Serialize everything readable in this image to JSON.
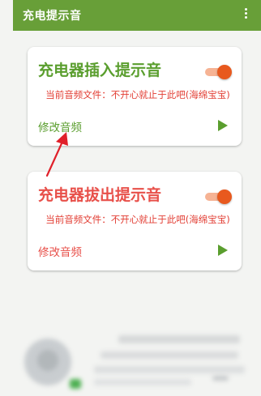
{
  "app_bar": {
    "title": "充电提示音",
    "menu_icon": "more-vert-icon",
    "color": "#689f38"
  },
  "cards": [
    {
      "title": "充电器插入提示音",
      "title_color": "#5a9e2e",
      "toggle_on": true,
      "current_file": "当前音频文件：不开心就止于此吧(海绵宝宝)",
      "modify_label": "修改音频",
      "modify_color": "#5a9e2e",
      "play_icon": "play-icon"
    },
    {
      "title": "充电器拔出提示音",
      "title_color": "#e8504a",
      "toggle_on": true,
      "current_file": "当前音频文件：不开心就止于此吧(海绵宝宝)",
      "modify_label": "修改音频",
      "modify_color": "#e8504a",
      "play_icon": "play-icon"
    }
  ],
  "colors": {
    "toggle_thumb": "#e8591e",
    "toggle_track": "#f6b394",
    "current_file_text": "#e23d33",
    "arrow": "#e0202a",
    "background": "#f3f4f2"
  }
}
